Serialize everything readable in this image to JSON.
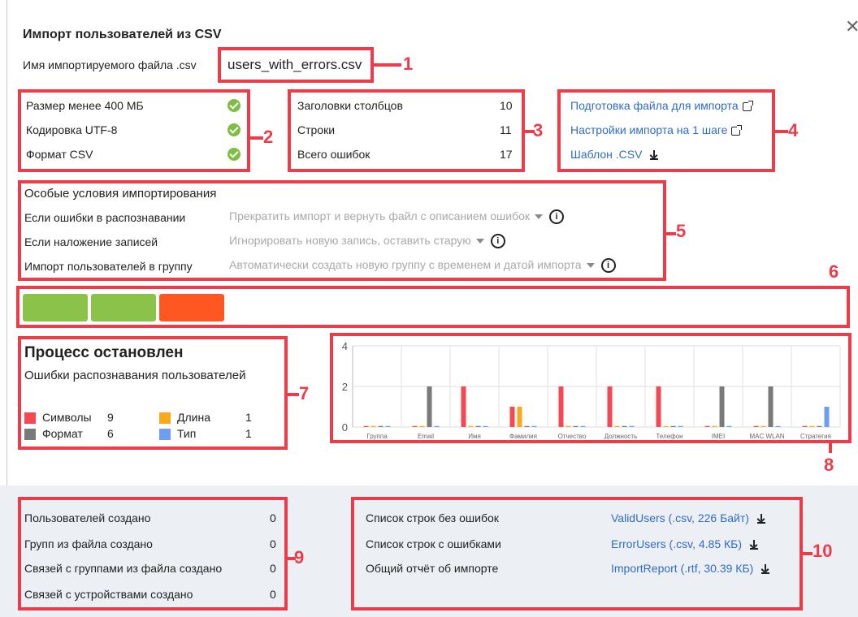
{
  "dialog": {
    "title": "Импорт пользователей из CSV",
    "close_icon": "close-icon",
    "file_label": "Имя импортируемого файла .csv",
    "file_name": "users_with_errors.csv"
  },
  "callouts": [
    "1",
    "2",
    "3",
    "4",
    "5",
    "6",
    "7",
    "8",
    "9",
    "10"
  ],
  "checks": [
    {
      "label": "Размер менее 400 МБ",
      "icon": "check-circle-icon"
    },
    {
      "label": "Кодировка UTF-8",
      "icon": "check-circle-icon"
    },
    {
      "label": "Формат CSV",
      "icon": "check-circle-icon"
    }
  ],
  "stats": [
    {
      "label": "Заголовки столбцов",
      "value": "10"
    },
    {
      "label": "Строки",
      "value": "11"
    },
    {
      "label": "Всего ошибок",
      "value": "17"
    }
  ],
  "links": [
    {
      "label": "Подготовка файла для импорта",
      "icon": "external-link-icon"
    },
    {
      "label": "Настройки импорта на 1 шаге",
      "icon": "external-link-icon"
    },
    {
      "label": "Шаблон .CSV",
      "icon": "download-icon"
    }
  ],
  "conditions": {
    "title": "Особые условия импортирования",
    "rows": [
      {
        "label": "Если ошибки в распознавании",
        "value": "Прекратить импорт и вернуть файл с описанием ошибок"
      },
      {
        "label": "Если наложение записей",
        "value": "Игнорировать новую запись, оставить старую"
      },
      {
        "label": "Импорт пользователей в группу",
        "value": "Автоматически создать новую группу с временем и датой импорта"
      }
    ]
  },
  "progress": {
    "steps": [
      {
        "status": "done",
        "color": "#8bc34a"
      },
      {
        "status": "done",
        "color": "#8bc34a"
      },
      {
        "status": "error",
        "color": "#ff5722"
      }
    ]
  },
  "status": {
    "title": "Процесс остановлен",
    "subtitle": "Ошибки распознавания пользователей",
    "legend": [
      {
        "name": "Символы",
        "count": "9",
        "color": "#f44953"
      },
      {
        "name": "Длина",
        "count": "1",
        "color": "#f8a91d"
      },
      {
        "name": "Формат",
        "count": "6",
        "color": "#7a7a7a"
      },
      {
        "name": "Тип",
        "count": "1",
        "color": "#6e9ef0"
      }
    ]
  },
  "chart_data": {
    "type": "bar",
    "categories": [
      "Группа",
      "Email",
      "Имя",
      "Фамилия",
      "Отчество",
      "Должность",
      "Телефон",
      "IMEI",
      "MAC WLAN",
      "Стратегия"
    ],
    "ylim": [
      0,
      4
    ],
    "yticks": [
      "0",
      "2",
      "4"
    ],
    "grid": true,
    "series": [
      {
        "name": "Символы",
        "color": "#f44953",
        "values": [
          0,
          0,
          2,
          1,
          2,
          2,
          2,
          0,
          0,
          0
        ]
      },
      {
        "name": "Длина",
        "color": "#f8a91d",
        "values": [
          0,
          0,
          0,
          1,
          0,
          0,
          0,
          0,
          0,
          0
        ]
      },
      {
        "name": "Формат",
        "color": "#7a7a7a",
        "values": [
          0,
          2,
          0,
          0,
          0,
          0,
          0,
          2,
          2,
          0
        ]
      },
      {
        "name": "Тип",
        "color": "#6e9ef0",
        "values": [
          0,
          0,
          0,
          0,
          0,
          0,
          0,
          0,
          0,
          1
        ]
      }
    ]
  },
  "results": [
    {
      "label": "Пользователей создано",
      "value": "0"
    },
    {
      "label": "Групп из файла создано",
      "value": "0"
    },
    {
      "label": "Связей с группами из файла создано",
      "value": "0"
    },
    {
      "label": "Связей с устройствами создано",
      "value": "0"
    }
  ],
  "downloads": [
    {
      "label": "Список строк без ошибок",
      "file": "ValidUsers (.csv, 226 Байт)",
      "icon": "download-icon"
    },
    {
      "label": "Список строк с ошибками",
      "file": "ErrorUsers (.csv, 4.85 КБ)",
      "icon": "download-icon"
    },
    {
      "label": "Общий отчёт об импорте",
      "file": "ImportReport (.rtf, 30.39 КБ)",
      "icon": "download-icon"
    }
  ]
}
